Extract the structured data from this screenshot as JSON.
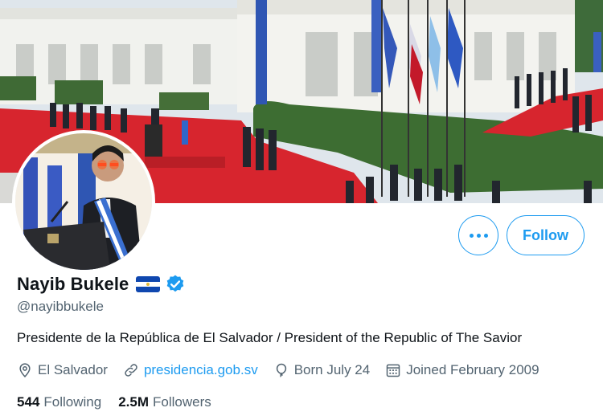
{
  "profile": {
    "name": "Nayib Bukele",
    "handle": "@nayibbukele",
    "bio": "Presidente de la República de El Salvador / President of the Republic of The Savior",
    "location": "El Salvador",
    "website": "presidencia.gob.sv",
    "birthday": "Born July 24",
    "joined": "Joined February 2009",
    "following_count": "544",
    "following_label": "Following",
    "followers_count": "2.5M",
    "followers_label": "Followers"
  },
  "actions": {
    "follow_label": "Follow"
  },
  "icons": {
    "more": "more-horizontal-icon",
    "verified": "verified-badge-icon",
    "flag": "el-salvador-flag-icon",
    "location": "location-pin-icon",
    "link": "link-icon",
    "birthday": "balloon-icon",
    "joined": "calendar-icon"
  },
  "colors": {
    "accent": "#1d9bf0",
    "text": "#0f1419",
    "secondary_text": "#536471",
    "flag_blue": "#0f47af"
  }
}
